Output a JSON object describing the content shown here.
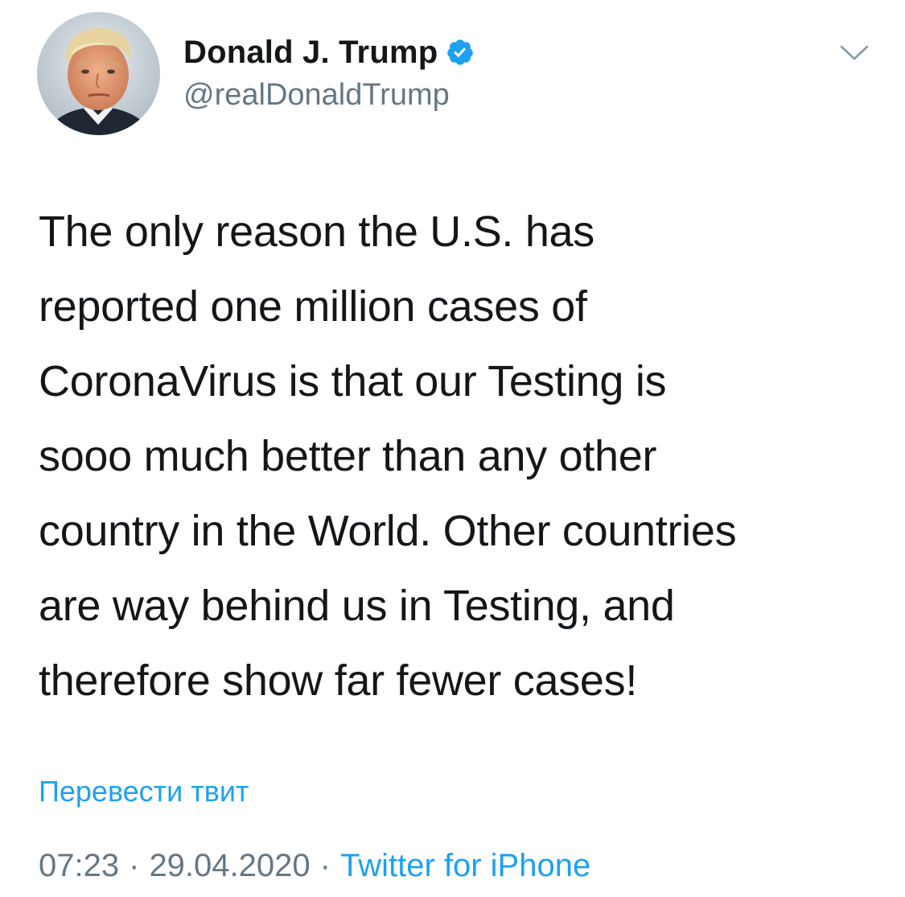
{
  "author": {
    "display_name": "Donald J. Trump",
    "handle": "@realDonaldTrump",
    "verified": true,
    "avatar_icon": "profile-photo",
    "verified_icon": "verified-badge-icon"
  },
  "menu": {
    "icon": "chevron-down-icon"
  },
  "tweet": {
    "text": "The only reason the U.S. has\nreported one million cases of\nCoronaVirus is that our Testing is\nsooo much better than any other\ncountry in the World. Other countries\nare way behind us in Testing, and\ntherefore show far fewer cases!"
  },
  "translate_link": "Перевести твит",
  "meta": {
    "time": "07:23",
    "separator": "·",
    "date": "29.04.2020",
    "source": "Twitter for iPhone"
  },
  "colors": {
    "accent": "#1da1f2",
    "text": "#14171a",
    "secondary": "#657786",
    "background": "#ffffff"
  }
}
